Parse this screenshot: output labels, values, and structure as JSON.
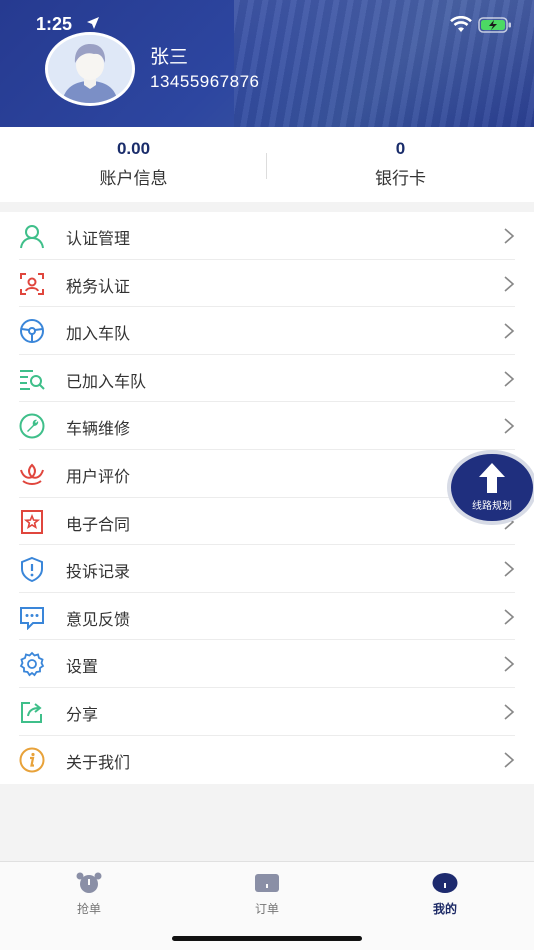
{
  "status_bar": {
    "time": "1:25"
  },
  "profile": {
    "name": "张三",
    "phone": "13455967876"
  },
  "stats": [
    {
      "value": "0.00",
      "label": "账户信息"
    },
    {
      "value": "0",
      "label": "银行卡"
    }
  ],
  "menu": {
    "items": [
      {
        "label": "认证管理",
        "icon": "user-verify-icon",
        "color": "#3fbf8a"
      },
      {
        "label": "税务认证",
        "icon": "face-scan-icon",
        "color": "#e0463d"
      },
      {
        "label": "加入车队",
        "icon": "steering-wheel-icon",
        "color": "#3a86d9"
      },
      {
        "label": "已加入车队",
        "icon": "list-search-icon",
        "color": "#3fbf8a"
      },
      {
        "label": "车辆维修",
        "icon": "wrench-icon",
        "color": "#3fbf8a"
      },
      {
        "label": "用户评价",
        "icon": "lotus-icon",
        "color": "#e0463d"
      },
      {
        "label": "电子合同",
        "icon": "contract-star-icon",
        "color": "#e0463d"
      },
      {
        "label": "投诉记录",
        "icon": "shield-alert-icon",
        "color": "#3a86d9"
      },
      {
        "label": "意见反馈",
        "icon": "chat-dots-icon",
        "color": "#3a86d9"
      },
      {
        "label": "设置",
        "icon": "gear-icon",
        "color": "#3a86d9"
      },
      {
        "label": "分享",
        "icon": "share-icon",
        "color": "#3fbf8a"
      },
      {
        "label": "关于我们",
        "icon": "info-icon",
        "color": "#e8a23a"
      }
    ]
  },
  "route_button": {
    "label": "线路规划"
  },
  "tabbar": {
    "tabs": [
      {
        "label": "抢单",
        "icon": "alarm-clock-icon",
        "active": false
      },
      {
        "label": "订单",
        "icon": "order-box-icon",
        "active": false
      },
      {
        "label": "我的",
        "icon": "profile-circle-icon",
        "active": true
      }
    ]
  },
  "colors": {
    "header": "#2a3f94",
    "accent": "#1f2f7e",
    "stat_value": "#1a2d6b"
  }
}
